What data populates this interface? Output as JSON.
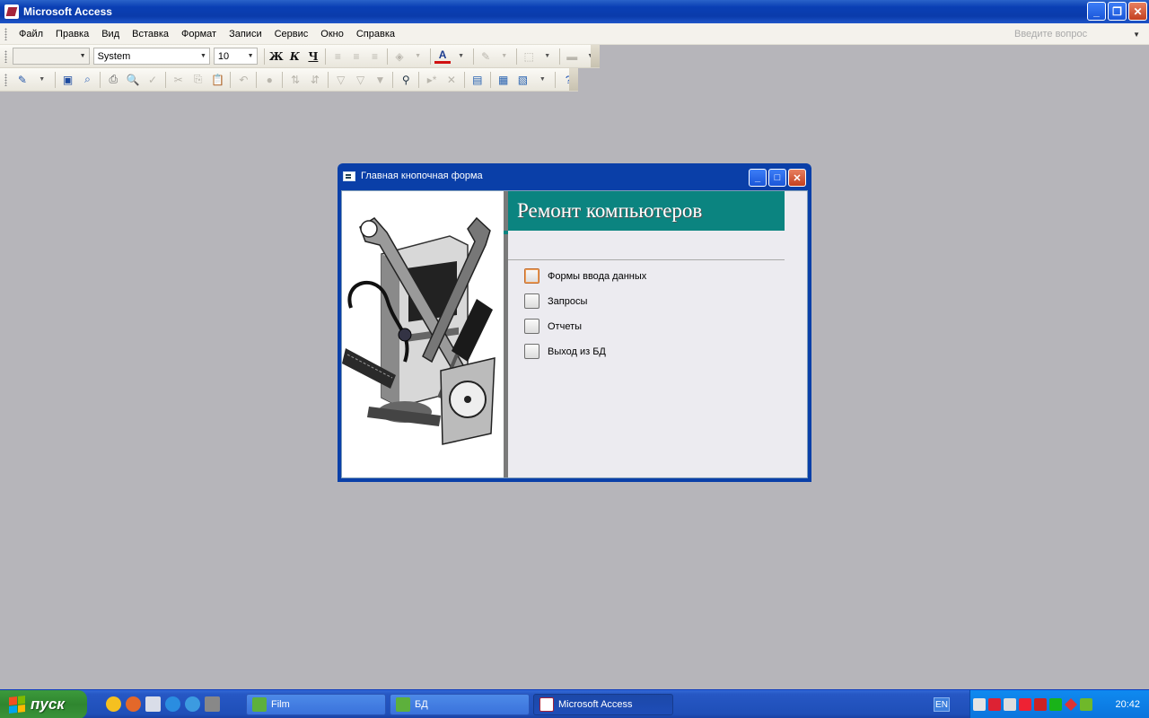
{
  "app": {
    "title": "Microsoft Access"
  },
  "menu": [
    "Файл",
    "Правка",
    "Вид",
    "Вставка",
    "Формат",
    "Записи",
    "Сервис",
    "Окно",
    "Справка"
  ],
  "ask": {
    "placeholder": "Введите вопрос"
  },
  "format_toolbar": {
    "object_combo": "",
    "font_name": "System",
    "font_size": "10",
    "bold": "Ж",
    "italic": "К",
    "underline": "Ч"
  },
  "child": {
    "title": "Главная кнопочная форма",
    "banner": "Ремонт компьютеров",
    "options": [
      {
        "label": "Формы ввода данных"
      },
      {
        "label": "Запросы"
      },
      {
        "label": "Отчеты"
      },
      {
        "label": "Выход из БД"
      }
    ]
  },
  "taskbar": {
    "start": "пуск",
    "tasks": [
      "Film",
      "БД",
      "Microsoft Access"
    ],
    "lang": "EN",
    "clock": "20:42"
  },
  "colors": {
    "banner": "#0b8480",
    "workspace": "#b6b5ba",
    "titlebar": "#0a3fb4"
  }
}
